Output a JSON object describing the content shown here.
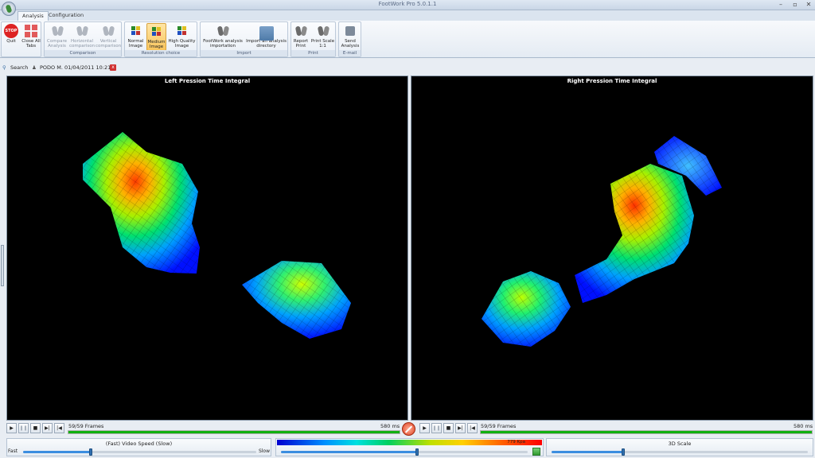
{
  "window": {
    "title": "FootWork Pro 5.0.1.1",
    "minimize_glyph": "–",
    "maximize_glyph": "▫",
    "close_glyph": "✕"
  },
  "tabs": [
    {
      "label": "Analysis",
      "active": true
    },
    {
      "label": "Configuration",
      "active": false
    }
  ],
  "ribbon": {
    "quit": {
      "label": "Quit",
      "icon": "stop-icon",
      "icon_text": "STOP"
    },
    "close_all_tabs": {
      "label_line1": "Close All",
      "label_line2": "Tabs",
      "icon": "close-tabs-icon"
    },
    "comparison": {
      "group_label": "Comparison",
      "compare": {
        "label_line1": "Compare",
        "label_line2": "Analysis"
      },
      "horizontal": {
        "label_line1": "Horizontal",
        "label_line2": "comparison"
      },
      "vertical": {
        "label_line1": "Vertical",
        "label_line2": "comparison"
      }
    },
    "resolution": {
      "group_label": "Resolution choice",
      "normal": {
        "label_line1": "Normal",
        "label_line2": "Image"
      },
      "medium": {
        "label_line1": "Medium",
        "label_line2": "Image",
        "selected": true
      },
      "high": {
        "label_line1": "High Quality",
        "label_line2": "Image"
      }
    },
    "import": {
      "group_label": "Import",
      "footwork": {
        "label_line1": "FootWork analysis",
        "label_line2": "importation"
      },
      "directory": {
        "label_line1": "Import an analysis",
        "label_line2": "directory"
      }
    },
    "print": {
      "group_label": "Print",
      "report": {
        "label_line1": "Report",
        "label_line2": "Print"
      },
      "scale": {
        "label_line1": "Print Scale",
        "label_line2": "1:1"
      }
    },
    "email": {
      "group_label": "E-mail",
      "send": {
        "label_line1": "Send",
        "label_line2": "Analysis"
      }
    }
  },
  "search": {
    "label": "Search",
    "patient_tab": "PODO M. 01/04/2011 10:21",
    "close_glyph": "x"
  },
  "viewers": {
    "left": {
      "title": "Left Pression Time Integral"
    },
    "right": {
      "title": "Right Pression Time Integral"
    }
  },
  "players": {
    "left": {
      "frames": "59/59 Frames",
      "time": "580 ms",
      "progress": 1.0
    },
    "right": {
      "frames": "59/59 Frames",
      "time": "580 ms",
      "progress": 1.0
    },
    "glyphs": {
      "play": "▶",
      "pause": "❚❚",
      "stop": "■",
      "next": "▶|",
      "prev": "|◀"
    }
  },
  "video_speed": {
    "label": "(Fast)  Video Speed  (Slow)",
    "fast": "Fast",
    "slow": "Slow",
    "value": 0.29
  },
  "pressure_scale": {
    "max_label": "779 Kpa",
    "value": 0.55
  },
  "scale_3d": {
    "label": "3D Scale",
    "value": 0.28
  },
  "colors": {
    "accent": "#3c8ee0",
    "progress": "#10b010",
    "selected": "#f8c55c",
    "danger": "#d22222"
  }
}
